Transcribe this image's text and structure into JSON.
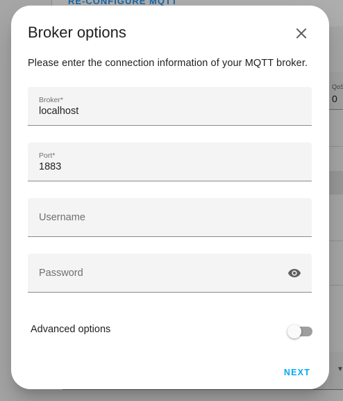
{
  "background": {
    "link_text": "RE-CONFIGURE MQTT",
    "qos_label": "QoS",
    "qos_value": "0"
  },
  "dialog": {
    "title": "Broker options",
    "description": "Please enter the connection information of your MQTT broker.",
    "fields": {
      "broker": {
        "label": "Broker*",
        "value": "localhost"
      },
      "port": {
        "label": "Port*",
        "value": "1883"
      },
      "username": {
        "placeholder": "Username"
      },
      "password": {
        "placeholder": "Password"
      }
    },
    "advanced": {
      "label": "Advanced options",
      "enabled": false
    },
    "next_label": "NEXT"
  },
  "colors": {
    "accent": "#03a9f4",
    "field_bg": "#f4f4f4",
    "scrim": "rgba(0,0,0,0.32)"
  },
  "icons": {
    "close": "close-icon",
    "password_visibility": "eye-icon"
  }
}
